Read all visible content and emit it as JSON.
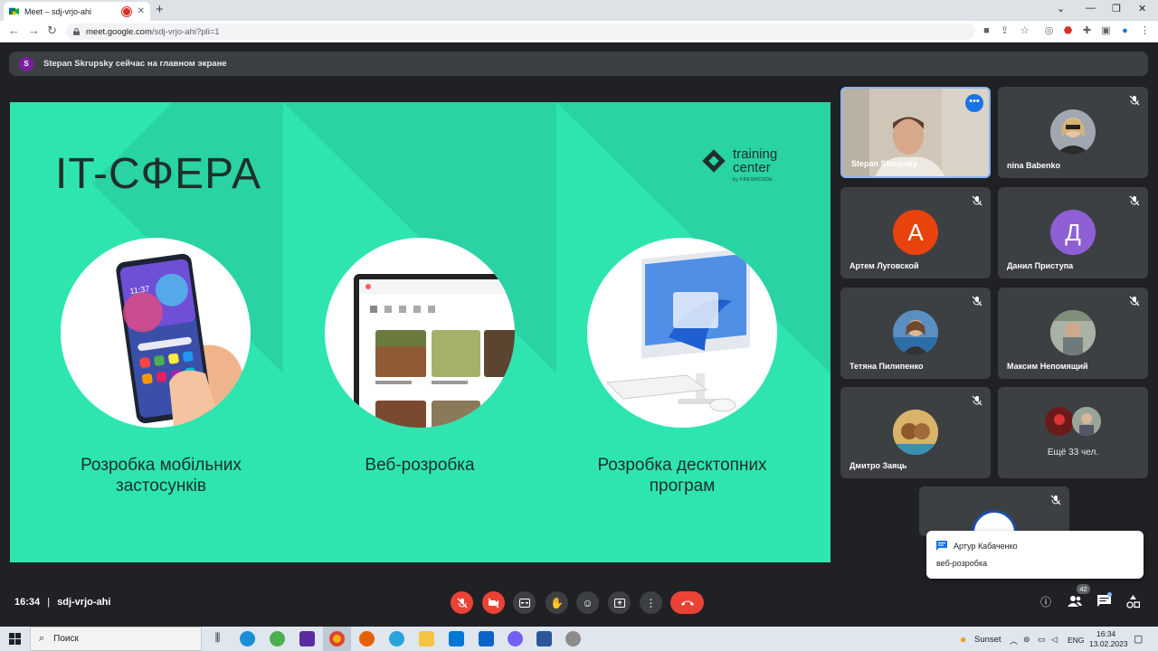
{
  "browser": {
    "tab_title": "Meet – sdj-vrjo-ahi",
    "tab_close": "✕",
    "new_tab": "+",
    "url_host": "meet.google.com",
    "url_path": "/sdj-vrjo-ahi?pli=1",
    "window_controls": [
      "⌄",
      "—",
      "❐",
      "✕"
    ]
  },
  "meet": {
    "presenting_initial": "S",
    "presenting_text": "Stepan Skrupsky сейчас на главном экране",
    "meeting_time": "16:34",
    "separator": "|",
    "meeting_code": "sdj-vrjo-ahi",
    "participants_count": "42"
  },
  "slide": {
    "title": "IT-СФЕРА",
    "logo_line1": "training",
    "logo_line2": "center",
    "logo_sub": "by FRESHCODE",
    "phone_time": "11:37",
    "captions": [
      [
        "Розробка мобільних",
        "застосунків"
      ],
      [
        "Веб-розробка"
      ],
      [
        "Розробка десктопних",
        "програм"
      ]
    ]
  },
  "participants": [
    {
      "name": "Stepan Skrupsky",
      "type": "video"
    },
    {
      "name": "nina Babenko",
      "type": "photo",
      "color": "#a0a7b0"
    },
    {
      "name": "Артем Луговской",
      "type": "letter",
      "letter": "А",
      "color": "#e8430d"
    },
    {
      "name": "Данил Приступа",
      "type": "letter",
      "letter": "Д",
      "color": "#8f5fd6"
    },
    {
      "name": "Тетяна Пилипенко",
      "type": "photo",
      "color": "#5b8fc2"
    },
    {
      "name": "Максим Непомящий",
      "type": "photo",
      "color": "#8e9a8a"
    },
    {
      "name": "Дмитро Заяць",
      "type": "photo",
      "color": "#c89a4a"
    }
  ],
  "more_participants": "Ещё 33 чел.",
  "chat": {
    "sender": "Артур Кабаченко",
    "message": "веб-розробка"
  },
  "taskbar": {
    "search_placeholder": "Поиск",
    "weather": "Sunset",
    "lang": "ENG",
    "time": "16:34",
    "date": "13.02.2023"
  },
  "colors": {
    "meet_bg": "#202124",
    "slide_bg": "#2ee5b0",
    "hangup": "#ea4335",
    "accent": "#1a73e8"
  }
}
